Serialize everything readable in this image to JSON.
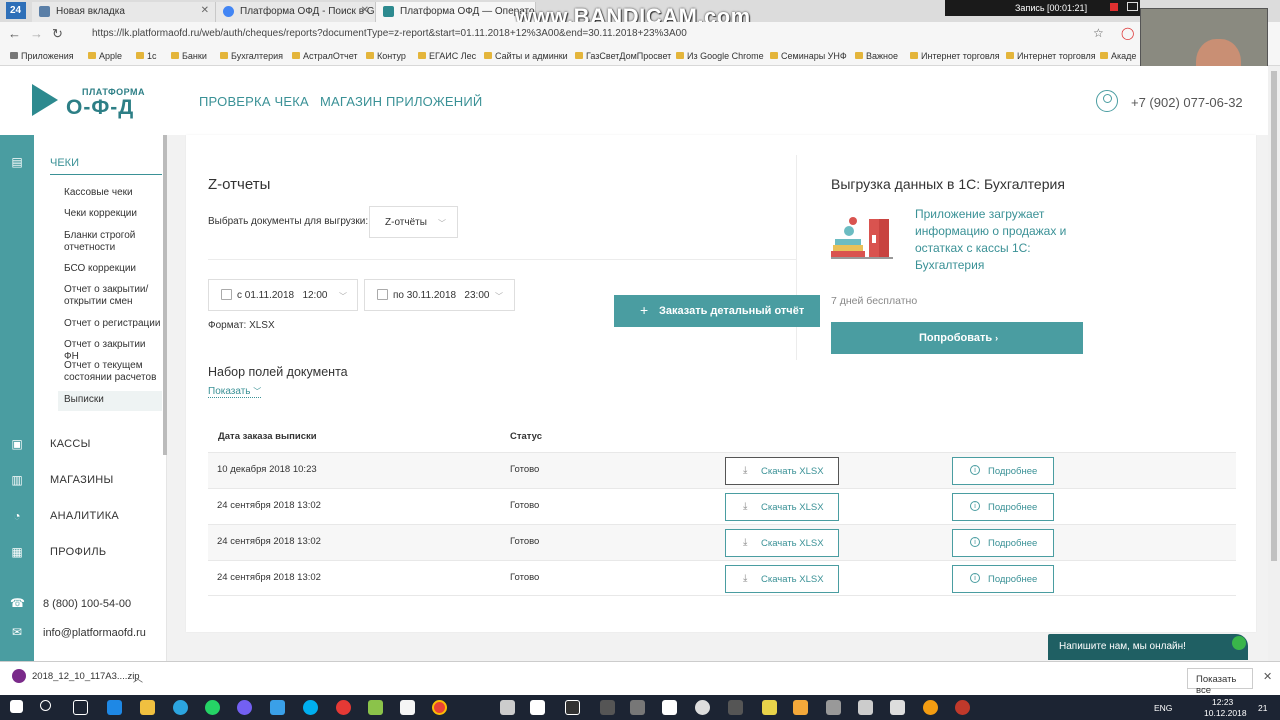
{
  "browser": {
    "tab_number": "24",
    "tabs": [
      {
        "label": "Новая вкладка"
      },
      {
        "label": "Платформа ОФД - Поиск в Goo"
      },
      {
        "label": "Платформа ОФД — Оператор"
      }
    ],
    "watermark": "www.BANDICAM.com",
    "recording": "Запись [00:01:21]",
    "url": "https://lk.platformaofd.ru/web/auth/cheques/reports?documentType=z-report&start=01.11.2018+12%3A00&end=30.11.2018+23%3A00",
    "bookmarks": [
      "Приложения",
      "Apple",
      "1с",
      "Банки",
      "Бухгалтерия",
      "АстралОтчет",
      "Контур",
      "ЕГАИС Лес",
      "Сайты и админки",
      "ГазСветДомПросвет",
      "Из Google Chrome",
      "Семинары УНФ",
      "Важное",
      "Интернет торговля",
      "Интернет торговля",
      "Акаде"
    ]
  },
  "header": {
    "logo_top": "ПЛАТФОРМА",
    "logo_main": "О-Ф-Д",
    "nav": [
      "ПРОВЕРКА ЧЕКА",
      "МАГАЗИН ПРИЛОЖЕНИЙ"
    ],
    "phone": "+7 (902) 077-06-32"
  },
  "sidebar": {
    "section": "ЧЕКИ",
    "sub_items": [
      "Кассовые чеки",
      "Чеки коррекции",
      "Бланки строгой отчетности",
      "БСО коррекции",
      "Отчет о закрытии/ открытии смен",
      "Отчет о регистрации",
      "Отчет о закрытии ФН",
      "Отчет о текущем состоянии расчетов",
      "Выписки"
    ],
    "main_items": [
      "КАССЫ",
      "МАГАЗИНЫ",
      "АНАЛИТИКА",
      "ПРОФИЛЬ"
    ],
    "phone": "8 (800) 100-54-00",
    "email": "info@platformaofd.ru"
  },
  "main": {
    "title": "Z-отчеты",
    "doc_label": "Выбрать документы для выгрузки:",
    "doc_value": "Z-отчёты",
    "date_from_prefix": "с",
    "date_from": "01.11.2018",
    "time_from": "12:00",
    "date_to_prefix": "по",
    "date_to": "30.11.2018",
    "time_to": "23:00",
    "format": "Формат: XLSX",
    "order_button": "Заказать детальный отчёт",
    "fields_title": "Набор полей документа",
    "show_link": "Показать"
  },
  "table": {
    "headers": [
      "Дата заказа выписки",
      "Статус"
    ],
    "download_label": "Скачать XLSX",
    "more_label": "Подробнее",
    "rows": [
      {
        "date": "10 декабря 2018 10:23",
        "status": "Готово"
      },
      {
        "date": "24 сентября 2018 13:02",
        "status": "Готово"
      },
      {
        "date": "24 сентября 2018 13:02",
        "status": "Готово"
      },
      {
        "date": "24 сентября 2018 13:02",
        "status": "Готово"
      }
    ]
  },
  "promo": {
    "title": "Выгрузка данных в 1С: Бухгалтерия",
    "text": "Приложение загружает информацию о продажах и остатках с кассы 1С: Бухгалтерия",
    "trial": "7 дней бесплатно",
    "button": "Попробовать"
  },
  "chat": {
    "label": "Напишите нам, мы онлайн!"
  },
  "download_bar": {
    "file": "2018_12_10_117A3....zip",
    "show_all": "Показать все"
  },
  "taskbar": {
    "lang": "ENG",
    "time": "12:23",
    "date": "10.12.2018",
    "notif": "21"
  },
  "colors": {
    "accent": "#4a9da1",
    "accent_text": "#3a9196"
  }
}
